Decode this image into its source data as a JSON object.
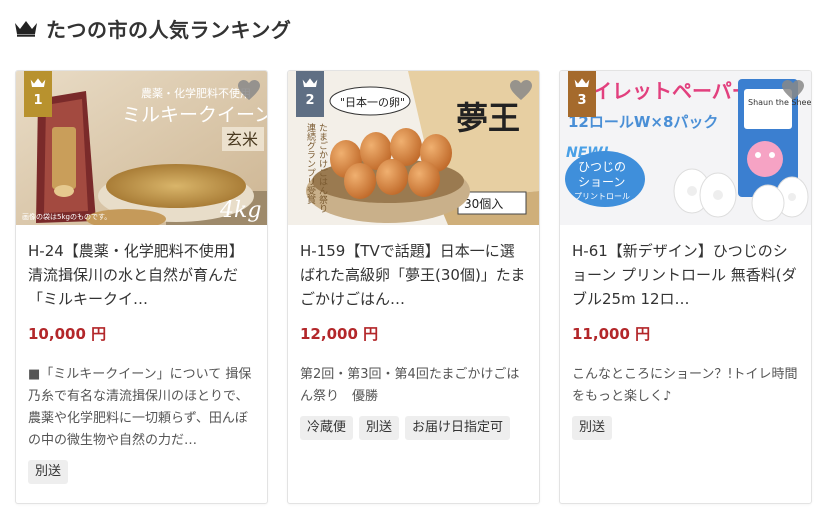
{
  "header": {
    "title": "たつの市の人気ランキング",
    "icon": "crown-icon"
  },
  "colors": {
    "gold": "#b8922e",
    "navy": "#5f6f84",
    "bronze": "#a56a2c",
    "price": "#b3272a"
  },
  "items": [
    {
      "rank": "1",
      "name": "H-24【農薬・化学肥料不使用】清流揖保川の水と自然が育んだ「ミルキークイ…",
      "price": "10,000 円",
      "desc": "■「ミルキークイーン」について 揖保乃糸で有名な清流揖保川のほとりで、農薬や化学肥料に一切頼らず、田んぼの中の微生物や自然の力だ…",
      "tags": [
        "別送"
      ],
      "image": {
        "t1": "農薬・化学肥料不使用",
        "t2": "ミルキークイーン",
        "t3": "玄米",
        "t4": "4kg",
        "note": "画像の袋は5kgのものです。"
      }
    },
    {
      "rank": "2",
      "name": "H-159【TVで話題】日本一に選ばれた高級卵「夢王(30個)」たまごかけごはん…",
      "price": "12,000 円",
      "desc": "第2回・第3回・第4回たまごかけごはん祭り　優勝",
      "tags": [
        "冷蔵便",
        "別送",
        "お届け日指定可"
      ],
      "image": {
        "t1": "\"日本一の卵\"",
        "t2": "夢王",
        "t3": "たまごかけごはん祭り",
        "t4": "連続グランプリ受賞",
        "t5": "30個入"
      }
    },
    {
      "rank": "3",
      "name": "H-61【新デザイン】ひつじのショーン プリントロール 無香料(ダブル25m 12ロ…",
      "price": "11,000 円",
      "desc": "こんなところにショーン？!トイレ時間をもっと楽しく♪",
      "tags": [
        "別送"
      ],
      "image": {
        "t1": "イレットペーパー",
        "t2": "12ロールW×8パック",
        "t3": "NEW!",
        "t4": "ひつじの",
        "t5": "ショーン",
        "t6": "プリントロール",
        "t7": "Shaun the Sheep"
      }
    }
  ]
}
